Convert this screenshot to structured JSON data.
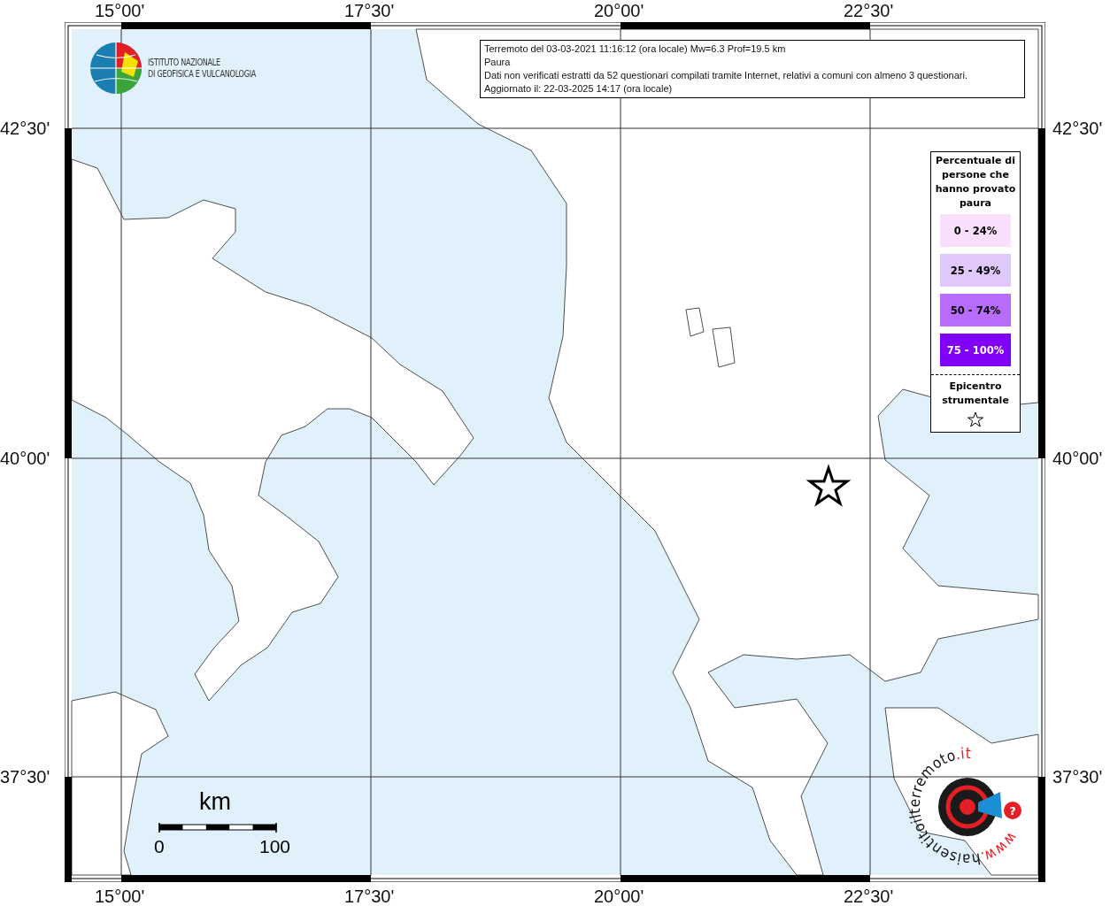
{
  "map": {
    "top_labels": [
      "15°00'",
      "17°30'",
      "20°00'",
      "22°30'"
    ],
    "bottom_labels": [
      "15°00'",
      "17°30'",
      "20°00'",
      "22°30'"
    ],
    "left_labels": [
      "42°30'",
      "40°00'",
      "37°30'"
    ],
    "right_labels": [
      "42°30'",
      "40°00'",
      "37°30'"
    ]
  },
  "institute_logo": {
    "lines": [
      "ISTITUTO NAZIONALE",
      "DI GEOFISICA E VULCANOLOGIA"
    ]
  },
  "info_box": {
    "lines": [
      "Terremoto del 03-03-2021 11:16:12 (ora locale) Mw=6.3 Prof=19.5 km",
      "Paura",
      "Dati non verificati estratti da 52 questionari compilati tramite Internet, relativi a comuni con almeno 3 questionari.",
      "Aggiornato il: 22-03-2025 14:17 (ora locale)"
    ]
  },
  "legend": {
    "title": "Percentuale di persone che hanno provato paura",
    "classes": [
      {
        "label": "0 - 24%",
        "color": "#f8e0fc"
      },
      {
        "label": "25 - 49%",
        "color": "#e0c8fc"
      },
      {
        "label": "50 - 74%",
        "color": "#b86cfc"
      },
      {
        "label": "75 - 100%",
        "color": "#8000f8"
      }
    ],
    "epicenter_label": "Epicentro strumentale"
  },
  "scale_bar": {
    "unit": "km",
    "start": "0",
    "end": "100"
  },
  "site_logo": {
    "url_parts": [
      {
        "text": "www.",
        "highlight": true
      },
      {
        "text": "haisentitoilterremoto",
        "highlight": false
      },
      {
        "text": ".it",
        "highlight": true
      }
    ],
    "badge": "?"
  }
}
